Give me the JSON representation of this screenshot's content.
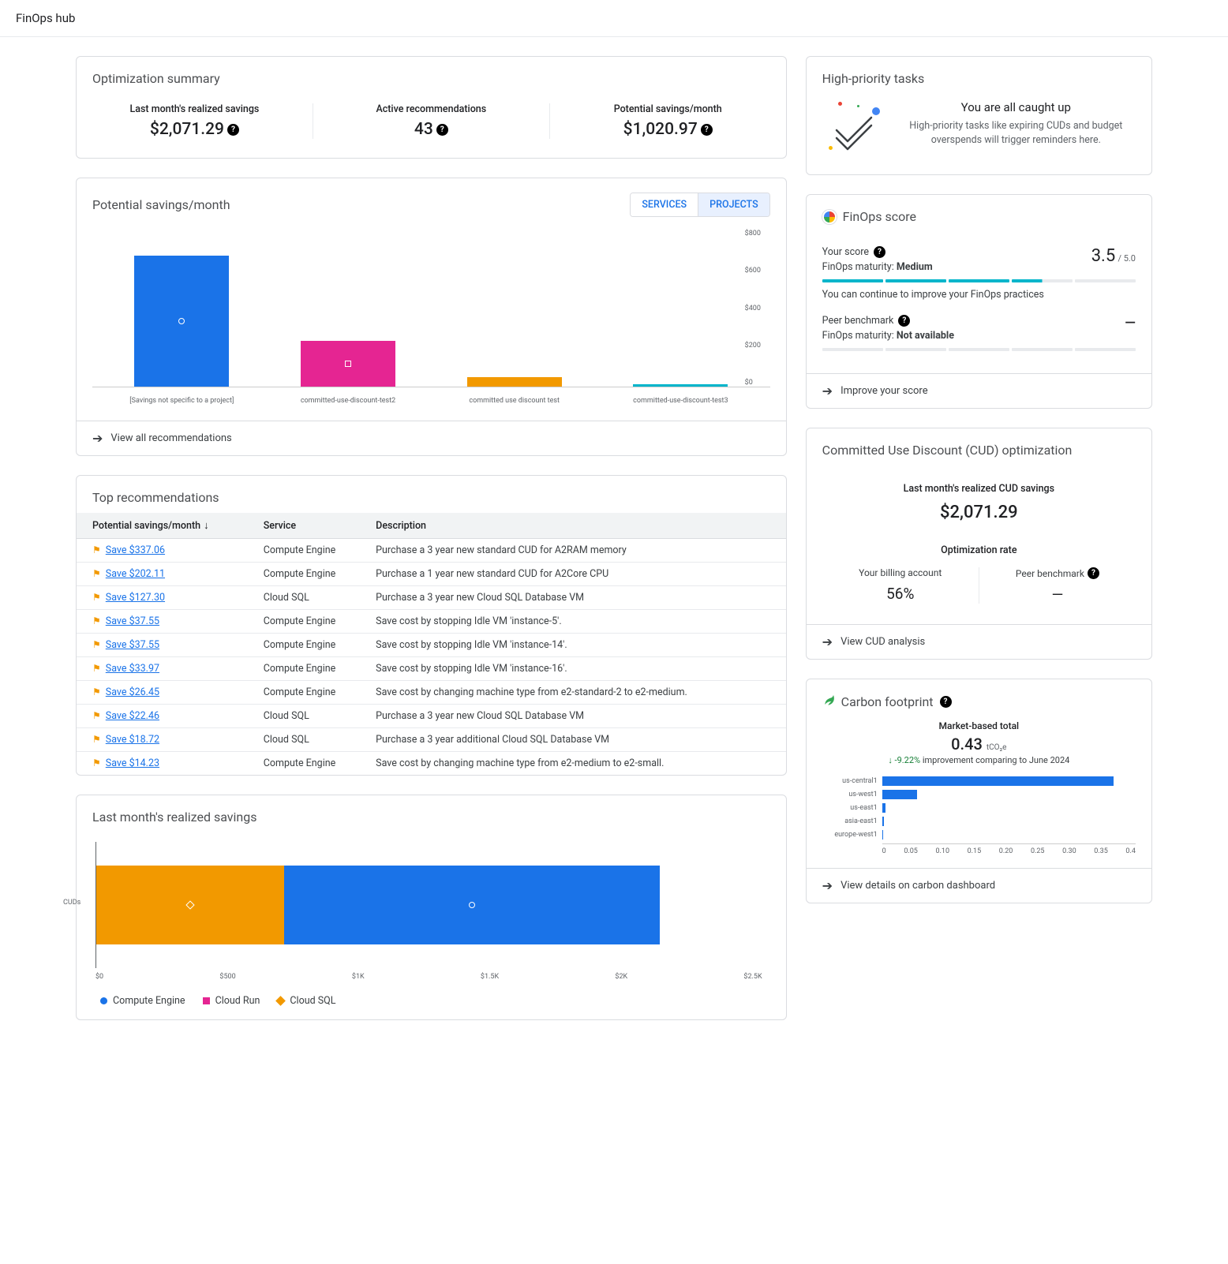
{
  "page_title": "FinOps hub",
  "optimization_summary": {
    "title": "Optimization summary",
    "items": [
      {
        "label": "Last month's realized savings",
        "value": "$2,071.29"
      },
      {
        "label": "Active recommendations",
        "value": "43"
      },
      {
        "label": "Potential savings/month",
        "value": "$1,020.97"
      }
    ]
  },
  "high_priority": {
    "title": "High-priority tasks",
    "headline": "You are all caught up",
    "text": "High-priority tasks like expiring CUDs and budget overspends will trigger reminders here."
  },
  "potential_savings": {
    "title": "Potential savings/month",
    "tabs": {
      "services": "SERVICES",
      "projects": "PROJECTS"
    },
    "footer": "View all recommendations"
  },
  "chart_data": [
    {
      "id": "potential_savings_by_project",
      "type": "bar",
      "title": "Potential savings/month",
      "ylabel": "$",
      "ylim": [
        0,
        800
      ],
      "y_ticks": [
        "$800",
        "$600",
        "$400",
        "$200",
        "$0"
      ],
      "categories": [
        "[Savings not specific to a project]",
        "committed-use-discount-test2",
        "committed use discount test",
        "committed-use-discount-test3"
      ],
      "values": [
        740,
        260,
        55,
        12
      ],
      "series_shapes": [
        "circle",
        "square",
        "none",
        "none"
      ],
      "colors": [
        "#1a73e8",
        "#e52592",
        "#f29900",
        "#00b5cb"
      ]
    },
    {
      "id": "last_month_realized_savings",
      "type": "bar",
      "orientation": "horizontal-stacked",
      "title": "Last month's realized savings",
      "xlabel": "$",
      "xlim": [
        0,
        2500
      ],
      "x_ticks": [
        "$0",
        "$500",
        "$1K",
        "$1.5K",
        "$2K",
        "$2.5K"
      ],
      "categories": [
        "CUDs"
      ],
      "series": [
        {
          "name": "Compute Engine",
          "values": [
            1400
          ],
          "color": "#1a73e8",
          "shape": "circle"
        },
        {
          "name": "Cloud Run",
          "values": [
            0
          ],
          "color": "#e52592",
          "shape": "square"
        },
        {
          "name": "Cloud SQL",
          "values": [
            700
          ],
          "color": "#f29900",
          "shape": "diamond"
        }
      ],
      "stack_order_rendered": [
        "Cloud SQL",
        "Compute Engine"
      ]
    },
    {
      "id": "carbon_footprint_bars",
      "type": "bar",
      "orientation": "horizontal",
      "title": "Carbon footprint by region (tCO2e)",
      "xlim": [
        0,
        0.4
      ],
      "x_ticks": [
        "0",
        "0.05",
        "0.10",
        "0.15",
        "0.20",
        "0.25",
        "0.30",
        "0.35",
        "0.4"
      ],
      "categories": [
        "us-central1",
        "us-west1",
        "us-east1",
        "asia-east1",
        "europe-west1"
      ],
      "values": [
        0.365,
        0.055,
        0.006,
        0.003,
        0.001
      ],
      "color": "#1a73e8"
    }
  ],
  "finops_score": {
    "title": "FinOps score",
    "your_score_label": "Your score",
    "maturity_label": "FinOps maturity:",
    "maturity_value": "Medium",
    "score": "3.5",
    "max": "/ 5.0",
    "hint": "You can continue to improve your FinOps practices",
    "peer_label": "Peer benchmark",
    "peer_maturity_value": "Not available",
    "peer_score": "—",
    "footer": "Improve your score"
  },
  "top_recommendations": {
    "title": "Top recommendations",
    "columns": {
      "savings": "Potential savings/month",
      "service": "Service",
      "description": "Description"
    },
    "rows": [
      {
        "savings": "Save $337.06",
        "service": "Compute Engine",
        "desc": "Purchase a 3 year new standard CUD for A2RAM memory"
      },
      {
        "savings": "Save $202.11",
        "service": "Compute Engine",
        "desc": "Purchase a 1 year new standard CUD for A2Core CPU"
      },
      {
        "savings": "Save $127.30",
        "service": "Cloud SQL",
        "desc": "Purchase a 3 year new Cloud SQL Database VM"
      },
      {
        "savings": "Save $37.55",
        "service": "Compute Engine",
        "desc": "Save cost by stopping Idle VM 'instance-5'."
      },
      {
        "savings": "Save $37.55",
        "service": "Compute Engine",
        "desc": "Save cost by stopping Idle VM 'instance-14'."
      },
      {
        "savings": "Save $33.97",
        "service": "Compute Engine",
        "desc": "Save cost by stopping Idle VM 'instance-16'."
      },
      {
        "savings": "Save $26.45",
        "service": "Compute Engine",
        "desc": "Save cost by changing machine type from e2-standard-2 to e2-medium."
      },
      {
        "savings": "Save $22.46",
        "service": "Cloud SQL",
        "desc": "Purchase a 3 year new Cloud SQL Database VM"
      },
      {
        "savings": "Save $18.72",
        "service": "Cloud SQL",
        "desc": "Purchase a 3 year additional Cloud SQL Database VM"
      },
      {
        "savings": "Save $14.23",
        "service": "Compute Engine",
        "desc": "Save cost by changing machine type from e2-medium to e2-small."
      }
    ]
  },
  "last_month_savings": {
    "title": "Last month's realized savings"
  },
  "cud": {
    "title": "Committed Use Discount (CUD) optimization",
    "label": "Last month's realized CUD savings",
    "value": "$2,071.29",
    "opt_label": "Optimization rate",
    "billing_label": "Your billing account",
    "billing_value": "56%",
    "peer_label": "Peer benchmark",
    "peer_value": "—",
    "footer": "View CUD analysis"
  },
  "carbon": {
    "title": "Carbon footprint",
    "market_label": "Market-based total",
    "value": "0.43",
    "unit": "tCO₂e",
    "improvement_pct": "-9.22%",
    "improvement_text": "improvement comparing to June 2024",
    "footer": "View details on carbon dashboard"
  }
}
